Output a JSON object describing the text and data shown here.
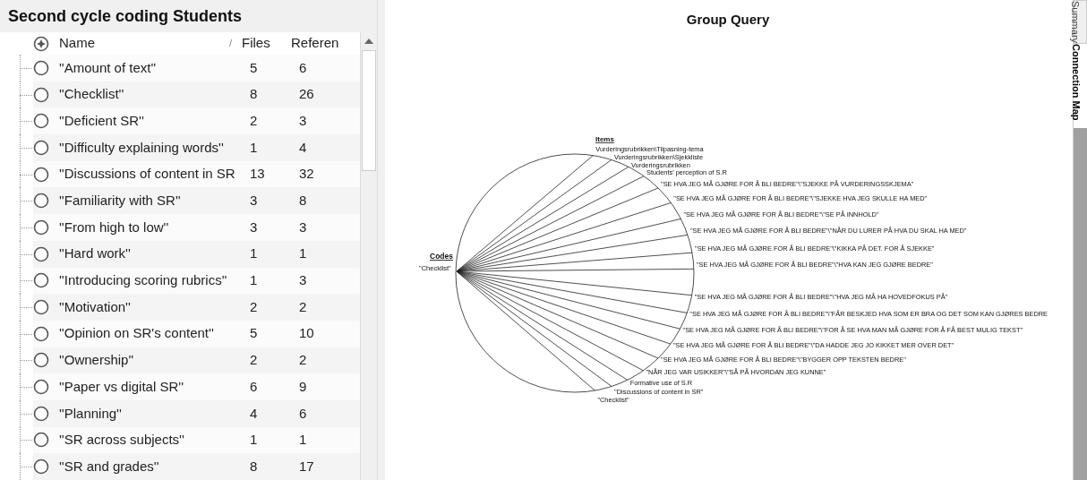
{
  "panel": {
    "title": "Second cycle coding Students",
    "sort_mark": "/",
    "columns": [
      {
        "label": "Name"
      },
      {
        "label": "Files"
      },
      {
        "label": "Referen"
      }
    ],
    "rows": [
      {
        "name": "''Amount of text''",
        "files": "5",
        "references": "6"
      },
      {
        "name": "''Checklist''",
        "files": "8",
        "references": "26"
      },
      {
        "name": "''Deficient SR''",
        "files": "2",
        "references": "3"
      },
      {
        "name": "''Difficulty explaining words''",
        "files": "1",
        "references": "4"
      },
      {
        "name": "''Discussions of content in SR",
        "files": "13",
        "references": "32"
      },
      {
        "name": "''Familiarity with SR''",
        "files": "3",
        "references": "8"
      },
      {
        "name": "''From high to low''",
        "files": "3",
        "references": "3"
      },
      {
        "name": "''Hard work''",
        "files": "1",
        "references": "1"
      },
      {
        "name": "''Introducing scoring rubrics''",
        "files": "1",
        "references": "3"
      },
      {
        "name": "''Motivation''",
        "files": "2",
        "references": "2"
      },
      {
        "name": "''Opinion on SR's content''",
        "files": "5",
        "references": "10"
      },
      {
        "name": "''Ownership''",
        "files": "2",
        "references": "2"
      },
      {
        "name": "''Paper vs digital SR''",
        "files": "6",
        "references": "9"
      },
      {
        "name": "''Planning''",
        "files": "4",
        "references": "6"
      },
      {
        "name": "''SR across subjects''",
        "files": "1",
        "references": "1"
      },
      {
        "name": "''SR and grades''",
        "files": "8",
        "references": "17"
      }
    ]
  },
  "map": {
    "title": "Group Query",
    "codes_heading": "Codes",
    "items_heading": "Items",
    "code": "\"Checklist\"",
    "items": [
      {
        "label": "Vurderingsrubrikken\\Tilpasning-tema"
      },
      {
        "label": "Vurderingsrubrikken\\Sjekkliste"
      },
      {
        "label": "Vurderingsrubrikken"
      },
      {
        "label": "Students' perception of S.R"
      },
      {
        "label": "\"SE HVA JEG MÅ GJØRE FOR Å BLI BEDRE\"\\\"SJEKKE PÅ VURDERINGSSKJEMA\""
      },
      {
        "label": "\"SE HVA JEG MÅ GJØRE FOR Å BLI BEDRE\"\\\"SJEKKE HVA JEG SKULLE HA MED\""
      },
      {
        "label": "\"SE HVA JEG MÅ GJØRE FOR Å BLI BEDRE\"\\\"SE PÅ INNHOLD\""
      },
      {
        "label": "\"SE HVA JEG MÅ GJØRE FOR Å BLI BEDRE\"\\\"NÅR DU LURER PÅ HVA DU SKAL HA MED\""
      },
      {
        "label": "\"SE HVA JEG MÅ GJØRE FOR Å BLI BEDRE\"\\\"KIKKA PÅ DET. FOR Å SJEKKE\""
      },
      {
        "label": "\"SE HVA JEG MÅ GJØRE FOR Å BLI BEDRE\"\\\"HVA KAN JEG GJØRE BEDRE\""
      },
      {
        "label": "\"SE HVA JEG MÅ GJØRE FOR Å BLI BEDRE\"\\\"HVA JEG MÅ HA HOVEDFOKUS PÅ\""
      },
      {
        "label": "\"SE HVA JEG MÅ GJØRE FOR Å BLI BEDRE\"\\\"FÅR BESKJED HVA SOM ER BRA OG DET SOM KAN GJØRES BEDRE"
      },
      {
        "label": "\"SE HVA JEG MÅ GJØRE FOR Å BLI BEDRE\"\\\"FOR Å SE HVA MAN MÅ GJØRE FOR Å FÅ BEST MULIG TEKST\""
      },
      {
        "label": "\"SE HVA JEG MÅ GJØRE FOR Å BLI BEDRE\"\\\"DA HADDE JEG JO KIKKET MER OVER DET\""
      },
      {
        "label": "\"SE HVA JEG MÅ GJØRE FOR Å BLI BEDRE\"\\\"BYGGER OPP TEKSTEN BEDRE\""
      },
      {
        "label": "\"NÅR JEG VAR USIKKER\"\\\"SÅ PÅ HVORDAN JEG KUNNE\""
      },
      {
        "label": "Formative use of S.R"
      },
      {
        "label": "\"Discussions of content in SR\""
      },
      {
        "label": "\"Checklist\""
      }
    ]
  },
  "tabs": [
    {
      "label": "Summary",
      "selected": false
    },
    {
      "label": "Connection Map",
      "selected": true
    }
  ]
}
